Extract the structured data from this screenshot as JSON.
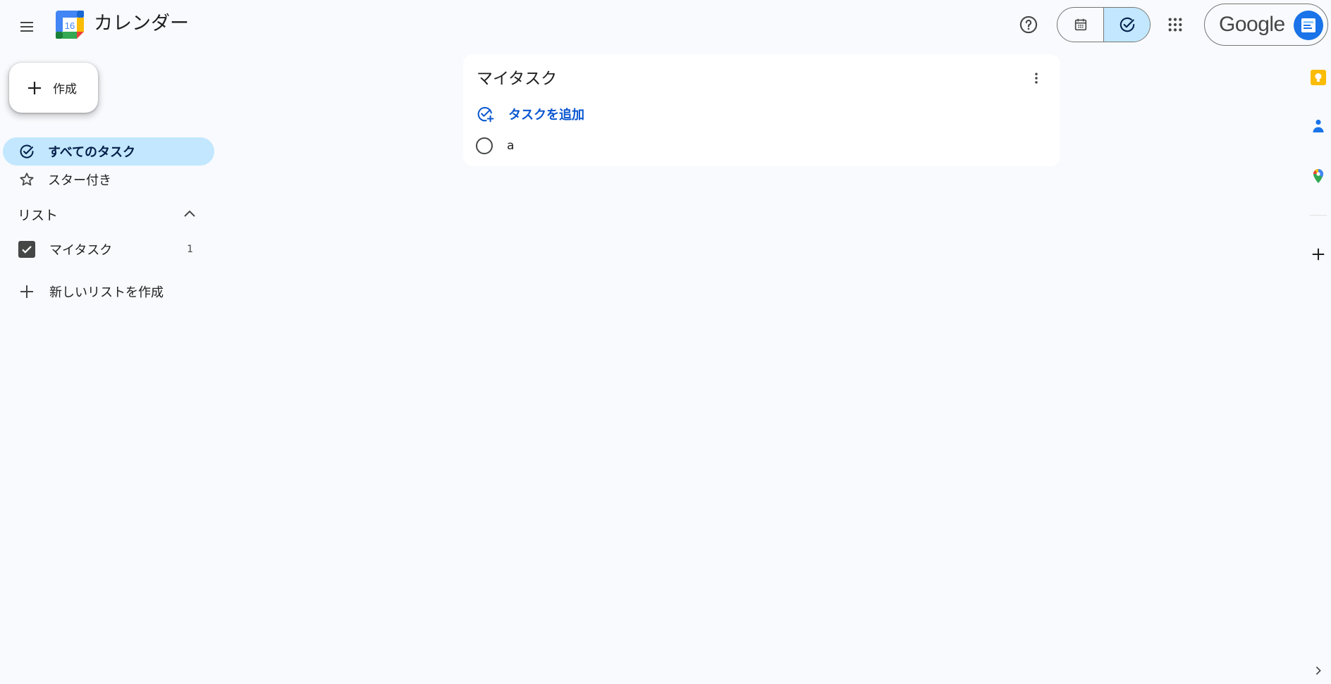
{
  "header": {
    "app_title": "カレンダー",
    "logo_day": "16",
    "account_brand": "Google"
  },
  "sidebar": {
    "create_label": "作成",
    "nav": [
      {
        "label": "すべてのタスク",
        "icon": "task-check-icon",
        "active": true
      },
      {
        "label": "スター付き",
        "icon": "star-icon",
        "active": false
      }
    ],
    "lists_title": "リスト",
    "lists": [
      {
        "label": "マイタスク",
        "count": "1",
        "checked": true
      }
    ],
    "new_list_label": "新しいリストを作成"
  },
  "main": {
    "card_title": "マイタスク",
    "add_task_label": "タスクを追加",
    "tasks": [
      {
        "title": "a",
        "done": false
      }
    ]
  },
  "side_panel": {
    "icons": [
      "keep-icon",
      "contacts-icon",
      "maps-icon",
      "add-icon"
    ]
  },
  "colors": {
    "background": "#f8fafd",
    "accent": "#0b57d0",
    "active_nav": "#c2e7ff"
  }
}
